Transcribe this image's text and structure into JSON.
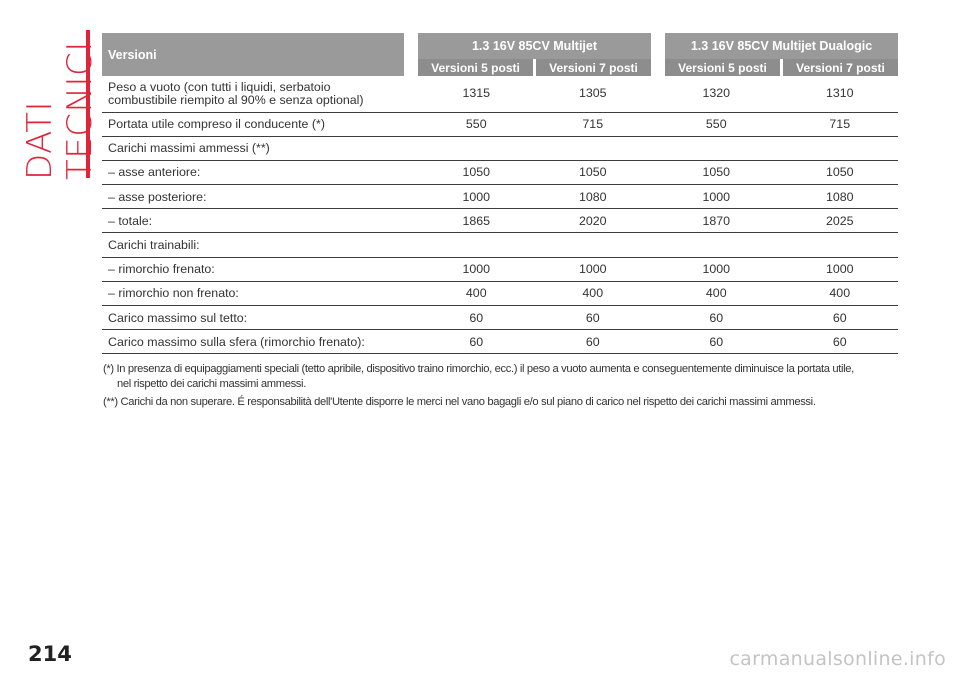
{
  "section_title": "DATI TECNICI",
  "page_number": "214",
  "watermark": "carmanualsonline.info",
  "table": {
    "header": {
      "versions_label": "Versioni",
      "engines": [
        "1.3 16V 85CV Multijet",
        "1.3 16V 85CV Multijet Dualogic"
      ],
      "subheaders": [
        "Versioni 5 posti",
        "Versioni 7 posti",
        "Versioni 5 posti",
        "Versioni 7 posti"
      ]
    },
    "rows": [
      {
        "label_line1": "Peso a vuoto (con tutti i liquidi, serbatoio",
        "label_line2": "combustibile riempito al 90% e senza optional)",
        "values": [
          "1315",
          "1305",
          "1320",
          "1310"
        ]
      },
      {
        "label": "Portata utile compreso il conducente (*)",
        "values": [
          "550",
          "715",
          "550",
          "715"
        ]
      },
      {
        "label": "Carichi massimi ammessi (**)",
        "values": []
      },
      {
        "label": "– asse anteriore:",
        "values": [
          "1050",
          "1050",
          "1050",
          "1050"
        ]
      },
      {
        "label": "– asse posteriore:",
        "values": [
          "1000",
          "1080",
          "1000",
          "1080"
        ]
      },
      {
        "label": "– totale:",
        "values": [
          "1865",
          "2020",
          "1870",
          "2025"
        ]
      },
      {
        "label": "Carichi trainabili:",
        "values": []
      },
      {
        "label": "– rimorchio frenato:",
        "values": [
          "1000",
          "1000",
          "1000",
          "1000"
        ]
      },
      {
        "label": "– rimorchio non frenato:",
        "values": [
          "400",
          "400",
          "400",
          "400"
        ]
      },
      {
        "label": "Carico massimo sul tetto:",
        "values": [
          "60",
          "60",
          "60",
          "60"
        ]
      },
      {
        "label": "Carico massimo sulla sfera (rimorchio frenato):",
        "values": [
          "60",
          "60",
          "60",
          "60"
        ]
      }
    ]
  },
  "notes": {
    "note1_line1": "(*) In presenza di equipaggiamenti speciali (tetto apribile, dispositivo traino rimorchio, ecc.) il peso a vuoto aumenta e conseguentemente diminuisce la portata utile,",
    "note1_line2": "nel rispetto dei carichi massimi ammessi.",
    "note2": "(**) Carichi da non superare. É responsabilità dell'Utente disporre le merci nel vano bagagli e/o sul piano di carico nel rispetto dei carichi massimi ammessi."
  }
}
